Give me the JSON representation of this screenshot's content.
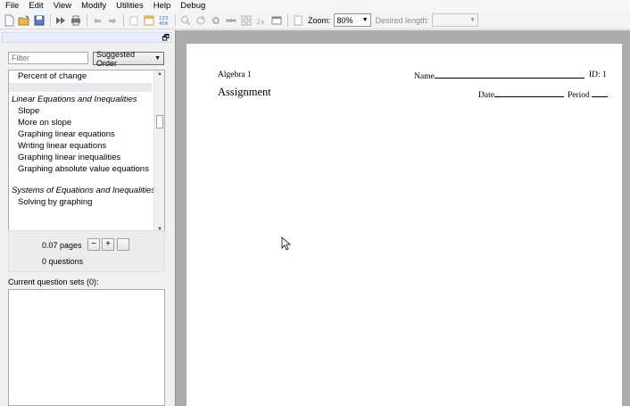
{
  "menu": [
    "File",
    "Edit",
    "View",
    "Modify",
    "Utilities",
    "Help",
    "Debug"
  ],
  "toolbar": {
    "zoom_label": "Zoom:",
    "zoom_value": "80%",
    "desired_length_label": "Desired length:",
    "desired_length_value": "",
    "numbers_icon_text": "123\n456"
  },
  "left_panel": {
    "filter_placeholder": "Filter",
    "order_select": "Suggested Order",
    "topics": [
      {
        "label": "Percent of change",
        "type": "item"
      },
      {
        "label": "",
        "type": "selected"
      },
      {
        "label": "Linear Equations and Inequalities",
        "type": "header"
      },
      {
        "label": "Slope",
        "type": "item"
      },
      {
        "label": "More on slope",
        "type": "item"
      },
      {
        "label": "Graphing linear equations",
        "type": "item"
      },
      {
        "label": "Writing linear equations",
        "type": "item"
      },
      {
        "label": "Graphing linear inequalities",
        "type": "item"
      },
      {
        "label": "Graphing absolute value equations",
        "type": "item"
      },
      {
        "label": "",
        "type": "spacer"
      },
      {
        "label": "Systems of Equations and Inequalities",
        "type": "header"
      },
      {
        "label": "Solving by graphing",
        "type": "item"
      }
    ],
    "pages": "0.07 pages",
    "questions": "0 questions",
    "minus_label": "−",
    "plus_label": "+",
    "current_sets_label": "Current question sets (0):"
  },
  "document": {
    "course": "Algebra 1",
    "title": "Assignment",
    "name_label": "Name",
    "id_label": "ID: 1",
    "date_label": "Date",
    "period_label": "Period"
  }
}
